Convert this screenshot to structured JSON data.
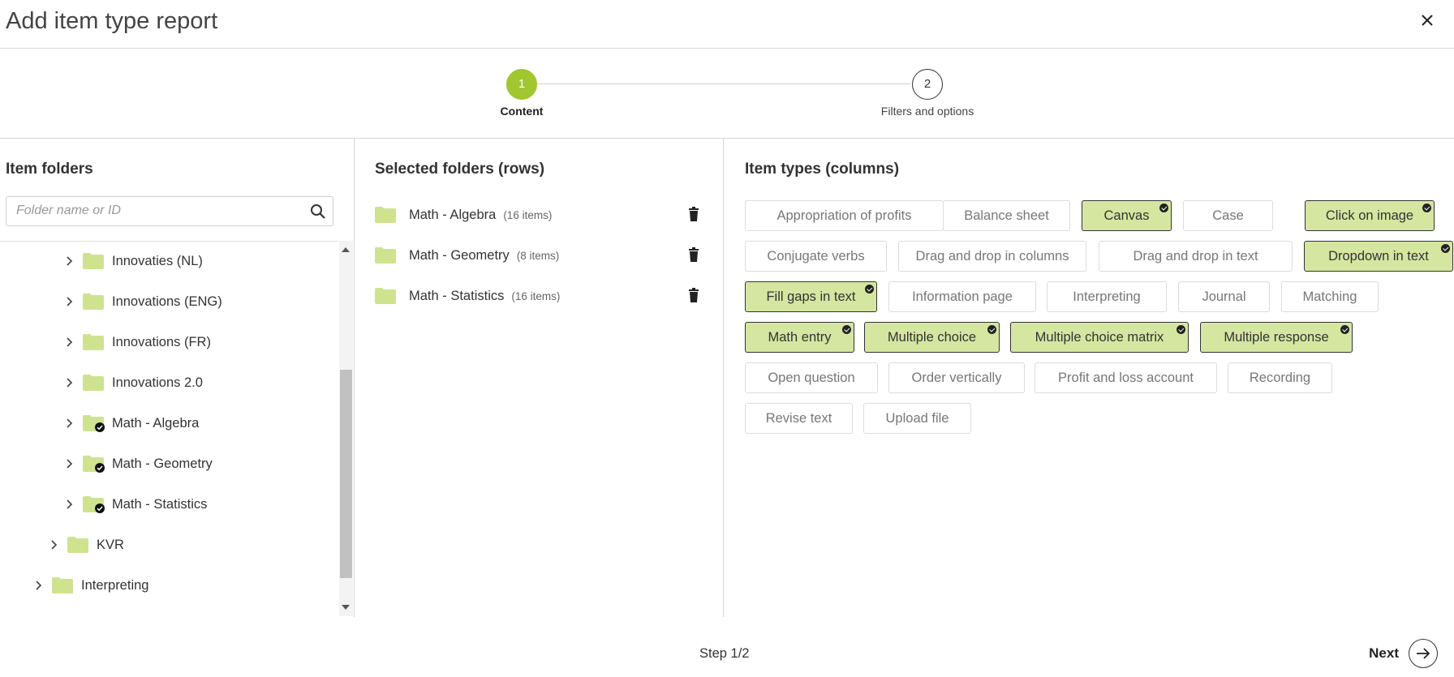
{
  "dialog": {
    "title": "Add item type report"
  },
  "colors": {
    "accent": "#a2c62f",
    "selected_chip": "#d5e6a1",
    "folder": "#cfe38f"
  },
  "stepper": {
    "steps": [
      {
        "number": "1",
        "label": "Content",
        "active": true
      },
      {
        "number": "2",
        "label": "Filters and options",
        "active": false
      }
    ]
  },
  "left": {
    "title": "Item folders",
    "search_placeholder": "Folder name or ID",
    "tree": [
      {
        "label": "Innovaties (NL)",
        "checked": false
      },
      {
        "label": "Innovations (ENG)",
        "checked": false
      },
      {
        "label": "Innovations (FR)",
        "checked": false
      },
      {
        "label": "Innovations 2.0",
        "checked": false
      },
      {
        "label": "Math - Algebra",
        "checked": true
      },
      {
        "label": "Math - Geometry",
        "checked": true
      },
      {
        "label": "Math - Statistics",
        "checked": true
      },
      {
        "label": "KVR",
        "checked": false
      },
      {
        "label": "Interpreting",
        "checked": false
      }
    ]
  },
  "middle": {
    "title": "Selected folders (rows)",
    "items": [
      {
        "name": "Math - Algebra",
        "count": "(16 items)"
      },
      {
        "name": "Math - Geometry",
        "count": "(8 items)"
      },
      {
        "name": "Math - Statistics",
        "count": "(16 items)"
      }
    ]
  },
  "right": {
    "title": "Item types (columns)",
    "types": [
      {
        "label": "Appropriation of profits",
        "selected": false
      },
      {
        "label": "Balance sheet",
        "selected": false
      },
      {
        "label": "Canvas",
        "selected": true
      },
      {
        "label": "Case",
        "selected": false
      },
      {
        "label": "Click on image",
        "selected": true
      },
      {
        "label": "Conjugate verbs",
        "selected": false
      },
      {
        "label": "Drag and drop in columns",
        "selected": false
      },
      {
        "label": "Drag and drop in text",
        "selected": false
      },
      {
        "label": "Dropdown in text",
        "selected": true
      },
      {
        "label": "Fill gaps in text",
        "selected": true
      },
      {
        "label": "Information page",
        "selected": false
      },
      {
        "label": "Interpreting",
        "selected": false
      },
      {
        "label": "Journal",
        "selected": false
      },
      {
        "label": "Matching",
        "selected": false
      },
      {
        "label": "Math entry",
        "selected": true
      },
      {
        "label": "Multiple choice",
        "selected": true
      },
      {
        "label": "Multiple choice matrix",
        "selected": true
      },
      {
        "label": "Multiple response",
        "selected": true
      },
      {
        "label": "Open question",
        "selected": false
      },
      {
        "label": "Order vertically",
        "selected": false
      },
      {
        "label": "Profit and loss account",
        "selected": false
      },
      {
        "label": "Recording",
        "selected": false
      },
      {
        "label": "Revise text",
        "selected": false
      },
      {
        "label": "Upload file",
        "selected": false
      }
    ]
  },
  "footer": {
    "step_info": "Step 1/2",
    "next_label": "Next"
  }
}
